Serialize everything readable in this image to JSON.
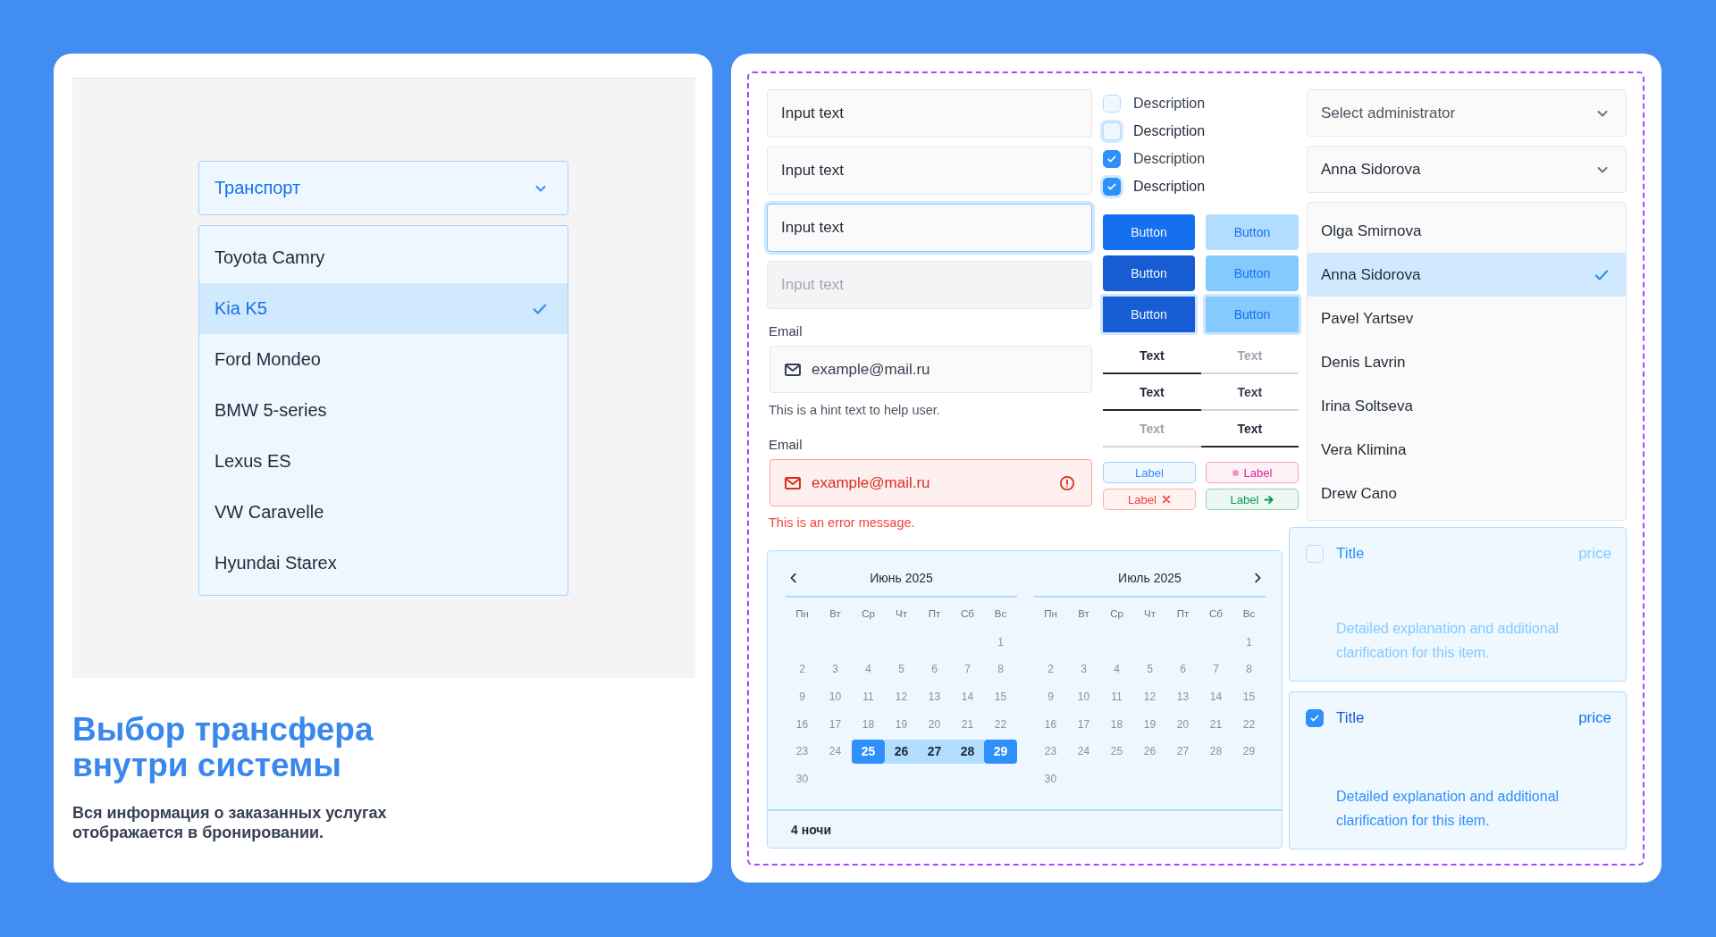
{
  "left_panel": {
    "dropdown": {
      "value": "Транспорт",
      "expanded": true
    },
    "options": [
      {
        "label": "Toyota Camry",
        "selected": false
      },
      {
        "label": "Kia K5",
        "selected": true
      },
      {
        "label": "Ford Mondeo",
        "selected": false
      },
      {
        "label": "BMW 5-series",
        "selected": false
      },
      {
        "label": "Lexus ES",
        "selected": false
      },
      {
        "label": "VW Caravelle",
        "selected": false
      },
      {
        "label": "Hyundai Starex",
        "selected": false
      }
    ],
    "heading": "Выбор трансфера внутри системы",
    "subtext": "Вся информация о заказанных услугах отображается в бронировании."
  },
  "right_panel": {
    "inputs": [
      {
        "value": "Input text",
        "focused": false,
        "disabled": false
      },
      {
        "value": "Input text",
        "focused": false,
        "disabled": false
      },
      {
        "value": "Input text",
        "focused": true,
        "disabled": false
      },
      {
        "value": "Input text",
        "focused": false,
        "disabled": true
      }
    ],
    "email_fields": [
      {
        "label": "Email",
        "value": "example@mail.ru",
        "error": false,
        "hint": "This is a hint text to help user."
      },
      {
        "label": "Email",
        "value": "example@mail.ru",
        "error": true,
        "hint": "This is an error message."
      }
    ],
    "checkboxes": [
      {
        "label": "Description",
        "checked": false,
        "focused": false
      },
      {
        "label": "Description",
        "checked": false,
        "focused": true
      },
      {
        "label": "Description",
        "checked": true,
        "focused": false
      },
      {
        "label": "Description",
        "checked": true,
        "focused": true
      }
    ],
    "buttons": [
      {
        "label": "Button",
        "kind": "primary",
        "hovered": false,
        "focused": false
      },
      {
        "label": "Button",
        "kind": "secondary",
        "hovered": false,
        "focused": false
      },
      {
        "label": "Button",
        "kind": "primary",
        "hovered": true,
        "focused": false
      },
      {
        "label": "Button",
        "kind": "secondary",
        "hovered": true,
        "focused": false
      },
      {
        "label": "Button",
        "kind": "primary",
        "hovered": true,
        "focused": true
      },
      {
        "label": "Button",
        "kind": "secondary",
        "hovered": true,
        "focused": true
      }
    ],
    "tab_groups": [
      {
        "tabs": [
          {
            "label": "Text",
            "selected": true,
            "hovered": false
          },
          {
            "label": "Text",
            "selected": false,
            "hovered": false
          }
        ]
      },
      {
        "tabs": [
          {
            "label": "Text",
            "selected": true,
            "hovered": false
          },
          {
            "label": "Text",
            "selected": false,
            "hovered": true
          }
        ]
      },
      {
        "tabs": [
          {
            "label": "Text",
            "selected": false,
            "hovered": false
          },
          {
            "label": "Text",
            "selected": true,
            "hovered": false
          }
        ]
      }
    ],
    "labels": [
      {
        "text": "Label",
        "kind": "plain",
        "color": "#2e90fa"
      },
      {
        "text": "Label",
        "kind": "dot",
        "color": "#dd2590"
      },
      {
        "text": "Label",
        "kind": "remove",
        "color": "#f04438"
      },
      {
        "text": "Label",
        "kind": "arrow",
        "color": "#039855"
      }
    ],
    "selects": [
      {
        "placeholder": "Select administrator"
      },
      {
        "value": "Anna Sidorova"
      }
    ],
    "admin_options": [
      {
        "label": "Olga Smirnova",
        "selected": false
      },
      {
        "label": "Anna Sidorova",
        "selected": true
      },
      {
        "label": "Pavel Yartsev",
        "selected": false
      },
      {
        "label": "Denis Lavrin",
        "selected": false
      },
      {
        "label": "Irina Soltseva",
        "selected": false
      },
      {
        "label": "Vera Klimina",
        "selected": false
      },
      {
        "label": "Drew Cano",
        "selected": false
      }
    ],
    "calendar": {
      "months": [
        {
          "title": "Июнь 2025",
          "weekdays": [
            "Пн",
            "Вт",
            "Ср",
            "Чт",
            "Пт",
            "Сб",
            "Вс"
          ],
          "weeks": [
            [
              {
                "kind": "blank"
              },
              {
                "kind": "blank"
              },
              {
                "kind": "blank"
              },
              {
                "kind": "blank"
              },
              {
                "kind": "blank"
              },
              {
                "kind": "blank"
              },
              {
                "kind": "day",
                "text": "1"
              }
            ],
            [
              {
                "kind": "day",
                "text": "2"
              },
              {
                "kind": "day",
                "text": "3"
              },
              {
                "kind": "day",
                "text": "4"
              },
              {
                "kind": "day",
                "text": "5"
              },
              {
                "kind": "day",
                "text": "6"
              },
              {
                "kind": "day",
                "text": "7"
              },
              {
                "kind": "day",
                "text": "8"
              }
            ],
            [
              {
                "kind": "day",
                "text": "9"
              },
              {
                "kind": "day",
                "text": "10"
              },
              {
                "kind": "day",
                "text": "11"
              },
              {
                "kind": "day",
                "text": "12"
              },
              {
                "kind": "day",
                "text": "13"
              },
              {
                "kind": "day",
                "text": "14"
              },
              {
                "kind": "day",
                "text": "15"
              }
            ],
            [
              {
                "kind": "day",
                "text": "16"
              },
              {
                "kind": "day",
                "text": "17"
              },
              {
                "kind": "day",
                "text": "18"
              },
              {
                "kind": "day",
                "text": "19"
              },
              {
                "kind": "day",
                "text": "20"
              },
              {
                "kind": "day",
                "text": "21"
              },
              {
                "kind": "day",
                "text": "22"
              }
            ],
            [
              {
                "kind": "day",
                "text": "23"
              },
              {
                "kind": "day",
                "text": "24"
              },
              {
                "kind": "range-end",
                "text": "25"
              },
              {
                "kind": "range-mid",
                "text": "26"
              },
              {
                "kind": "range-mid",
                "text": "27"
              },
              {
                "kind": "range-mid",
                "text": "28"
              },
              {
                "kind": "range-end",
                "text": "29"
              }
            ],
            [
              {
                "kind": "day",
                "text": "30"
              },
              {
                "kind": "blank"
              },
              {
                "kind": "blank"
              },
              {
                "kind": "blank"
              },
              {
                "kind": "blank"
              },
              {
                "kind": "blank"
              },
              {
                "kind": "blank"
              }
            ]
          ]
        },
        {
          "title": "Июль 2025",
          "weekdays": [
            "Пн",
            "Вт",
            "Ср",
            "Чт",
            "Пт",
            "Сб",
            "Вс"
          ],
          "weeks": [
            [
              {
                "kind": "blank"
              },
              {
                "kind": "blank"
              },
              {
                "kind": "blank"
              },
              {
                "kind": "blank"
              },
              {
                "kind": "blank"
              },
              {
                "kind": "blank"
              },
              {
                "kind": "day",
                "text": "1"
              }
            ],
            [
              {
                "kind": "day",
                "text": "2"
              },
              {
                "kind": "day",
                "text": "3"
              },
              {
                "kind": "day",
                "text": "4"
              },
              {
                "kind": "day",
                "text": "5"
              },
              {
                "kind": "day",
                "text": "6"
              },
              {
                "kind": "day",
                "text": "7"
              },
              {
                "kind": "day",
                "text": "8"
              }
            ],
            [
              {
                "kind": "day",
                "text": "9"
              },
              {
                "kind": "day",
                "text": "10"
              },
              {
                "kind": "day",
                "text": "11"
              },
              {
                "kind": "day",
                "text": "12"
              },
              {
                "kind": "day",
                "text": "13"
              },
              {
                "kind": "day",
                "text": "14"
              },
              {
                "kind": "day",
                "text": "15"
              }
            ],
            [
              {
                "kind": "day",
                "text": "16"
              },
              {
                "kind": "day",
                "text": "17"
              },
              {
                "kind": "day",
                "text": "18"
              },
              {
                "kind": "day",
                "text": "19"
              },
              {
                "kind": "day",
                "text": "20"
              },
              {
                "kind": "day",
                "text": "21"
              },
              {
                "kind": "day",
                "text": "22"
              }
            ],
            [
              {
                "kind": "day",
                "text": "23"
              },
              {
                "kind": "day",
                "text": "24"
              },
              {
                "kind": "day",
                "text": "25"
              },
              {
                "kind": "day",
                "text": "26"
              },
              {
                "kind": "day",
                "text": "27"
              },
              {
                "kind": "day",
                "text": "28"
              },
              {
                "kind": "day",
                "text": "29"
              }
            ],
            [
              {
                "kind": "day",
                "text": "30"
              },
              {
                "kind": "blank"
              },
              {
                "kind": "blank"
              },
              {
                "kind": "blank"
              },
              {
                "kind": "blank"
              },
              {
                "kind": "blank"
              },
              {
                "kind": "blank"
              }
            ]
          ]
        }
      ],
      "footer": "4 ночи"
    },
    "option_cards": [
      {
        "title": "Title",
        "price": "price",
        "description": "Detailed explanation and additional clarification for this item.",
        "checked": false
      },
      {
        "title": "Title",
        "price": "price",
        "description": "Detailed explanation and additional clarification for this item.",
        "checked": true
      }
    ]
  }
}
